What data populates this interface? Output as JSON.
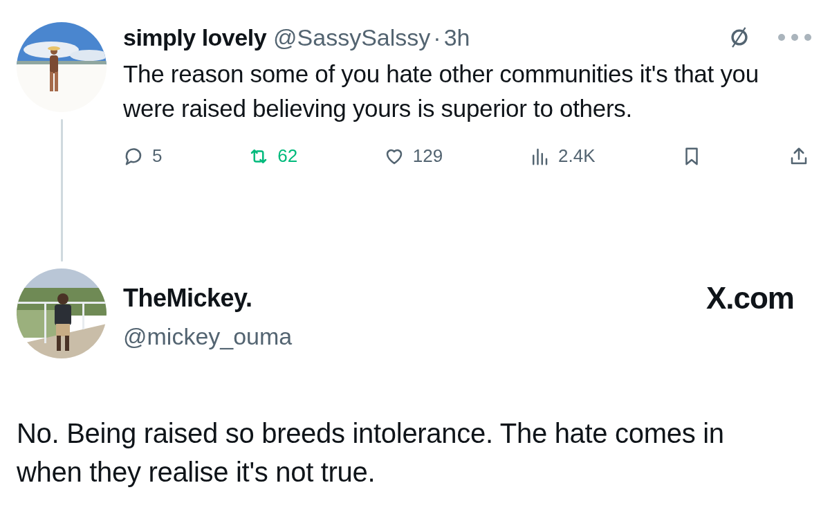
{
  "quoted_post": {
    "display_name": "simply lovely",
    "handle": "@SassySalssy",
    "separator": "·",
    "time": "3h",
    "text": "The reason some of you hate other communities it's that you were raised believing yours is superior to others.",
    "actions": [
      {
        "kind": "reply",
        "count": "5",
        "active": false
      },
      {
        "kind": "repost",
        "count": "62",
        "active": true
      },
      {
        "kind": "like",
        "count": "129",
        "active": false
      },
      {
        "kind": "views",
        "count": "2.4K"
      },
      {
        "kind": "bookmark",
        "active": false
      },
      {
        "kind": "share"
      }
    ]
  },
  "reply_post": {
    "display_name": "TheMickey.",
    "handle": "@mickey_ouma",
    "logo_text": "X.com",
    "text": "No. Being raised so breeds intolerance. The hate comes in when they realise it's not true."
  }
}
